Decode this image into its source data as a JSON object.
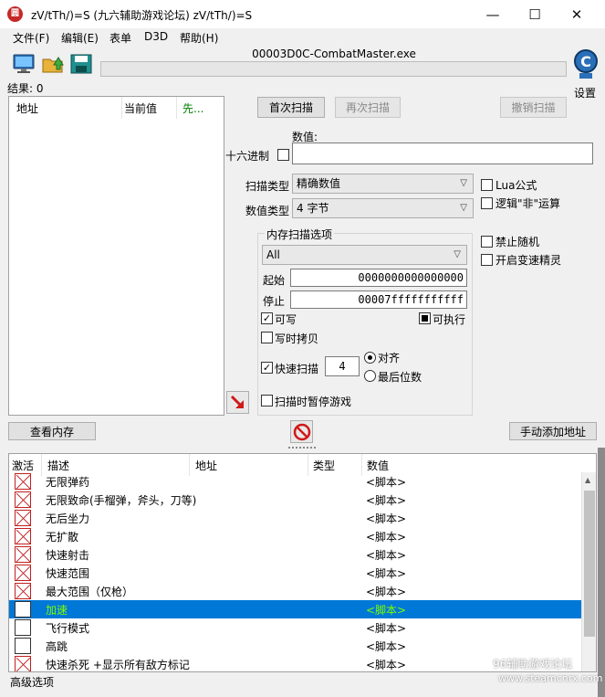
{
  "window": {
    "title": "zV/tTh/)=S (九六辅助游戏论坛) zV/tTh/)=S",
    "icon_text": "圆",
    "minimize": "—",
    "maximize": "☐",
    "close": "✕"
  },
  "menu": [
    "文件(F)",
    "编辑(E)",
    "表单",
    "D3D",
    "帮助(H)"
  ],
  "toolbar": {
    "process_title": "00003D0C-CombatMaster.exe",
    "settings_label": "设置",
    "icons": [
      "monitor-icon",
      "open-folder-icon",
      "save-disk-icon"
    ]
  },
  "results": {
    "label": "结果: 0"
  },
  "found_list": {
    "headers": [
      "地址",
      "当前值",
      "先..."
    ],
    "header_colors": [
      "#000000",
      "#000000",
      "#008000"
    ]
  },
  "scan": {
    "first_scan": "首次扫描",
    "next_scan": "再次扫描",
    "undo_scan": "撤销扫描",
    "value_label": "数值:",
    "hex_label": "十六进制",
    "value_input": "",
    "scan_type_label": "扫描类型",
    "scan_type_value": "精确数值",
    "value_type_label": "数值类型",
    "value_type_value": "4 字节",
    "lua_formula": "Lua公式",
    "logic_not": "逻辑\"非\"运算",
    "no_random": "禁止随机",
    "speedhack": "开启变速精灵"
  },
  "memory_options": {
    "group_title": "内存扫描选项",
    "region_value": "All",
    "start_label": "起始",
    "start_value": "0000000000000000",
    "stop_label": "停止",
    "stop_value": "00007fffffffffff",
    "writable": "可写",
    "writable_checked": true,
    "executable": "可执行",
    "executable_checked": true,
    "copy_on_write": "写时拷贝",
    "fast_scan": "快速扫描",
    "fast_scan_checked": true,
    "fast_scan_value": "4",
    "align": "对齐",
    "last_digits": "最后位数",
    "pause_game": "扫描时暂停游戏"
  },
  "bottom_buttons": {
    "view_memory": "查看内存",
    "add_address": "手动添加地址"
  },
  "cheat_table": {
    "headers": [
      "激活",
      "描述",
      "地址",
      "类型",
      "数值"
    ],
    "rows": [
      {
        "desc": "无限弹药",
        "value": "<脚本>",
        "box": "cross",
        "selected": false
      },
      {
        "desc": "无限致命(手榴弹，斧头，刀等)",
        "value": "<脚本>",
        "box": "cross",
        "selected": false
      },
      {
        "desc": "无后坐力",
        "value": "<脚本>",
        "box": "cross",
        "selected": false
      },
      {
        "desc": "无扩散",
        "value": "<脚本>",
        "box": "cross",
        "selected": false
      },
      {
        "desc": "快速射击",
        "value": "<脚本>",
        "box": "cross",
        "selected": false
      },
      {
        "desc": "快速范围",
        "value": "<脚本>",
        "box": "cross",
        "selected": false
      },
      {
        "desc": "最大范围（仅枪）",
        "value": "<脚本>",
        "box": "cross",
        "selected": false
      },
      {
        "desc": "加速",
        "value": "<脚本>",
        "box": "plain",
        "selected": true
      },
      {
        "desc": "飞行模式",
        "value": "<脚本>",
        "box": "plain",
        "selected": false
      },
      {
        "desc": "高跳",
        "value": "<脚本>",
        "box": "plain",
        "selected": false
      },
      {
        "desc": "快速杀死 +显示所有敌方标记",
        "value": "<脚本>",
        "box": "cross",
        "selected": false
      }
    ]
  },
  "footer": {
    "advanced_options": "高级选项",
    "watermark": "96辅助游戏论坛",
    "watermark_url": "www.steamcnrx.com"
  }
}
